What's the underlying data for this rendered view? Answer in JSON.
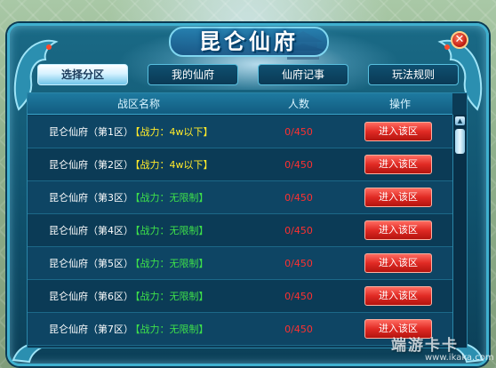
{
  "window": {
    "title": "昆仑仙府",
    "close_label": "✕"
  },
  "tabs": [
    {
      "label": "选择分区",
      "active": true
    },
    {
      "label": "我的仙府",
      "active": false
    },
    {
      "label": "仙府记事",
      "active": false
    },
    {
      "label": "玩法规则",
      "active": false
    }
  ],
  "table": {
    "headers": {
      "name": "战区名称",
      "count": "人数",
      "op": "操作"
    },
    "rows": [
      {
        "name": "昆仑仙府（第1区）",
        "power": "【战力：4w以下】",
        "power_color": "yellow",
        "count": "0/450",
        "button": "进入该区"
      },
      {
        "name": "昆仑仙府（第2区）",
        "power": "【战力：4w以下】",
        "power_color": "yellow",
        "count": "0/450",
        "button": "进入该区"
      },
      {
        "name": "昆仑仙府（第3区）",
        "power": "【战力：无限制】",
        "power_color": "green",
        "count": "0/450",
        "button": "进入该区"
      },
      {
        "name": "昆仑仙府（第4区）",
        "power": "【战力：无限制】",
        "power_color": "green",
        "count": "0/450",
        "button": "进入该区"
      },
      {
        "name": "昆仑仙府（第5区）",
        "power": "【战力：无限制】",
        "power_color": "green",
        "count": "0/450",
        "button": "进入该区"
      },
      {
        "name": "昆仑仙府（第6区）",
        "power": "【战力：无限制】",
        "power_color": "green",
        "count": "0/450",
        "button": "进入该区"
      },
      {
        "name": "昆仑仙府（第7区）",
        "power": "【战力：无限制】",
        "power_color": "green",
        "count": "0/450",
        "button": "进入该区"
      }
    ]
  },
  "scrollbar": {
    "up_arrow": "▲"
  },
  "watermark": {
    "brand": "端游卡卡",
    "url": "www.ikaka.com"
  },
  "colors": {
    "power_yellow": "#ffea2a",
    "power_green": "#3ee04a",
    "count_red": "#ff3030",
    "button_red": "#e02a24"
  }
}
